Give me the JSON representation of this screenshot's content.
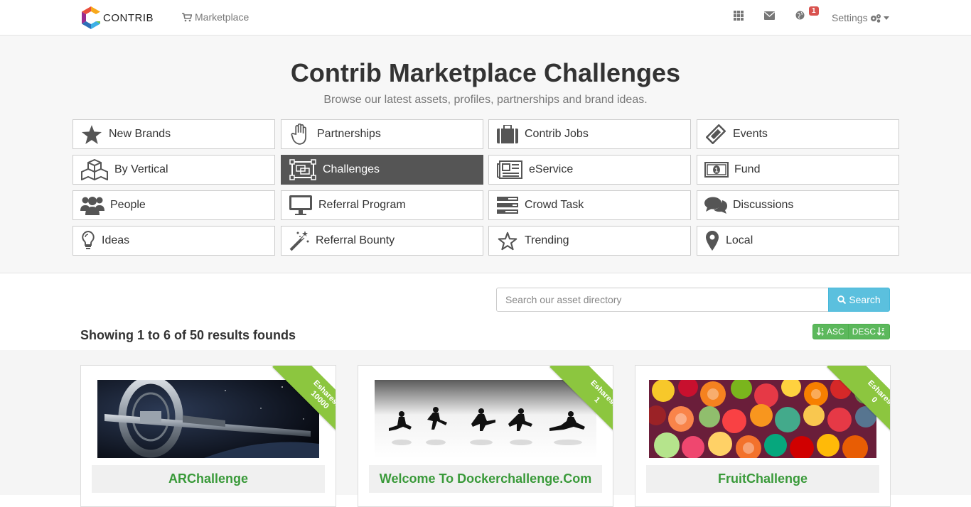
{
  "nav": {
    "brand": "CONTRIB",
    "marketplace_label": "Marketplace",
    "notification_count": "1",
    "settings_label": "Settings"
  },
  "hero": {
    "title": "Contrib Marketplace Challenges",
    "subtitle": "Browse our latest assets, profiles, partnerships and brand ideas."
  },
  "categories": [
    {
      "label": "New Brands",
      "icon": "star-icon"
    },
    {
      "label": "Partnerships",
      "icon": "hand-icon"
    },
    {
      "label": "Contrib Jobs",
      "icon": "briefcase-icon"
    },
    {
      "label": "Events",
      "icon": "ticket-icon"
    },
    {
      "label": "By Vertical",
      "icon": "cubes-icon"
    },
    {
      "label": "Challenges",
      "icon": "object-group-icon",
      "active": true
    },
    {
      "label": "eService",
      "icon": "newspaper-icon"
    },
    {
      "label": "Fund",
      "icon": "money-icon"
    },
    {
      "label": "People",
      "icon": "users-icon"
    },
    {
      "label": "Referral Program",
      "icon": "desktop-icon"
    },
    {
      "label": "Crowd Task",
      "icon": "tasks-icon"
    },
    {
      "label": "Discussions",
      "icon": "comments-icon"
    },
    {
      "label": "Ideas",
      "icon": "lightbulb-icon"
    },
    {
      "label": "Referral Bounty",
      "icon": "magic-wand-icon"
    },
    {
      "label": "Trending",
      "icon": "star-outline-icon"
    },
    {
      "label": "Local",
      "icon": "map-marker-icon"
    }
  ],
  "search": {
    "placeholder": "Search our asset directory",
    "button_label": "Search"
  },
  "results": {
    "summary": "Showing 1 to 6 of 50 results founds",
    "sort_asc": "ASC",
    "sort_desc": "DESC"
  },
  "cards": [
    {
      "title": "ARChallenge",
      "ribbon_label": "Eshares:",
      "ribbon_value": "10000"
    },
    {
      "title": "Welcome To Dockerchallenge.Com",
      "ribbon_label": "Eshares:",
      "ribbon_value": "1"
    },
    {
      "title": "FruitChallenge",
      "ribbon_label": "Eshares:",
      "ribbon_value": "0"
    }
  ],
  "colors": {
    "accent_green": "#3a9a3a",
    "ribbon_green": "#8cc63f",
    "search_blue": "#5bc0de",
    "active_category": "#555555",
    "badge_red": "#d9534f"
  }
}
